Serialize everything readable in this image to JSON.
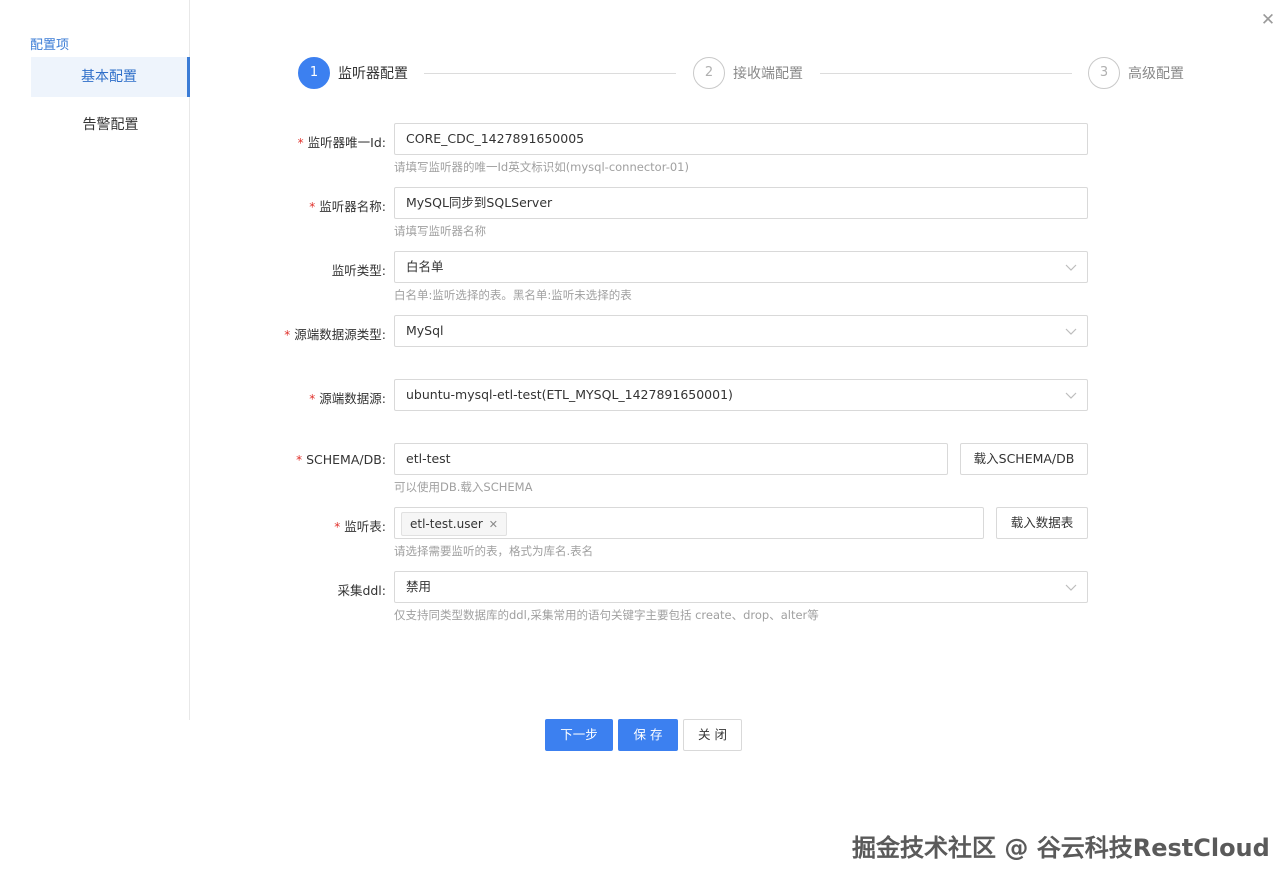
{
  "dialog": {
    "close_icon": "close-icon"
  },
  "sidebar": {
    "title": "配置项",
    "items": [
      {
        "label": "基本配置",
        "active": true
      },
      {
        "label": "告警配置",
        "active": false
      }
    ]
  },
  "steps": [
    {
      "number": "1",
      "label": "监听器配置",
      "active": true
    },
    {
      "number": "2",
      "label": "接收端配置",
      "active": false
    },
    {
      "number": "3",
      "label": "高级配置",
      "active": false
    }
  ],
  "form": {
    "listener_id": {
      "label": "监听器唯一Id:",
      "required": true,
      "value": "CORE_CDC_1427891650005",
      "help": "请填写监听器的唯一Id英文标识如(mysql-connector-01)"
    },
    "listener_name": {
      "label": "监听器名称:",
      "required": true,
      "value": "MySQL同步到SQLServer",
      "help": "请填写监听器名称"
    },
    "listen_type": {
      "label": "监听类型:",
      "required": false,
      "value": "白名单",
      "help": "白名单:监听选择的表。黑名单:监听未选择的表"
    },
    "source_type": {
      "label": "源端数据源类型:",
      "required": true,
      "value": "MySql"
    },
    "source": {
      "label": "源端数据源:",
      "required": true,
      "value": "ubuntu-mysql-etl-test(ETL_MYSQL_1427891650001)"
    },
    "schema": {
      "label": "SCHEMA/DB:",
      "required": true,
      "value": "etl-test",
      "button": "载入SCHEMA/DB",
      "help": "可以使用DB.载入SCHEMA"
    },
    "tables": {
      "label": "监听表:",
      "required": true,
      "tags": [
        "etl-test.user"
      ],
      "button": "载入数据表",
      "help": "请选择需要监听的表，格式为库名.表名"
    },
    "ddl": {
      "label": "采集ddl:",
      "required": false,
      "value": "禁用",
      "help": "仅支持同类型数据库的ddl,采集常用的语句关键字主要包括 create、drop、alter等"
    }
  },
  "footer": {
    "next": "下一步",
    "save": "保 存",
    "close": "关 闭"
  },
  "watermark": "掘金技术社区 @ 谷云科技RestCloud",
  "colors": {
    "primary": "#3c80f0",
    "required": "#e0302a",
    "help": "#a0a0a0"
  }
}
